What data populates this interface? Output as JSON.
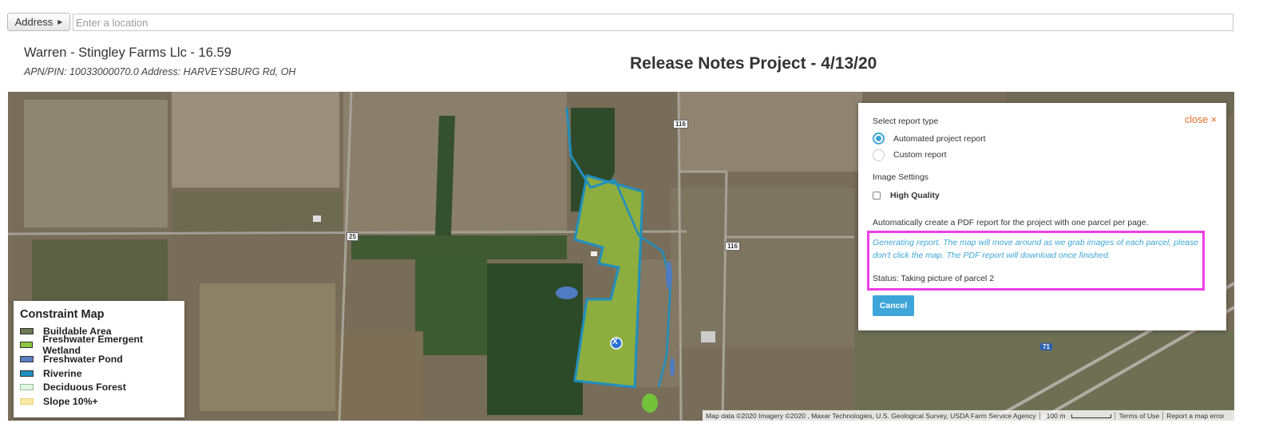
{
  "address": {
    "button_label": "Address",
    "placeholder": "Enter a location",
    "value": ""
  },
  "parcel": {
    "title": "Warren - Stingley Farms Llc - 16.59",
    "subtitle": "APN/PIN: 10033000070.0 Address: HARVEYSBURG Rd, OH"
  },
  "project_title": "Release Notes Project - 4/13/20",
  "map": {
    "road_labels": [
      "116",
      "25",
      "116",
      "71"
    ],
    "parcel_marker": "X"
  },
  "legend": {
    "title": "Constraint Map",
    "items": [
      {
        "label": "Buildable Area",
        "color": "#6b7a52"
      },
      {
        "label": "Freshwater Emergent Wetland",
        "color": "#8dc63f"
      },
      {
        "label": "Freshwater Pond",
        "color": "#5b7fc4"
      },
      {
        "label": "Riverine",
        "color": "#1f8fbf"
      },
      {
        "label": "Deciduous Forest",
        "color": "#e3f5e3"
      },
      {
        "label": "Slope 10%+",
        "color": "#fbe9a6"
      }
    ]
  },
  "dialog": {
    "close_label": "close ×",
    "report_type_label": "Select report type",
    "options": [
      {
        "label": "Automated project report",
        "selected": true
      },
      {
        "label": "Custom report",
        "selected": false
      }
    ],
    "image_settings_label": "Image Settings",
    "high_quality_label": "High Quality",
    "description": "Automatically create a PDF report for the project with one parcel per page.",
    "generating_message": "Generating report. The map will move around as we grab images of each parcel, please don't click the map. The PDF report will download once finished.",
    "status": "Status: Taking picture of parcel 2",
    "cancel_label": "Cancel",
    "accent_color": "#3ea6d8",
    "highlight_color": "#ee3ee8"
  },
  "attribution": {
    "map_data": "Map data ©2020 Imagery ©2020 , Maxar Technologies, U.S. Geological Survey, USDA Farm Service Agency",
    "scale": "100 m",
    "terms": "Terms of Use",
    "report_error": "Report a map error"
  }
}
